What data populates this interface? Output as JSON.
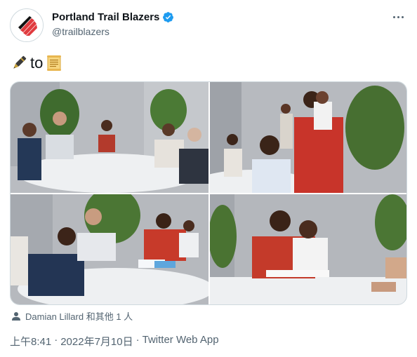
{
  "author": {
    "display_name": "Portland Trail Blazers",
    "handle": "@trailblazers",
    "verified": true,
    "avatar_icon": "trail-blazers-pinwheel-logo",
    "brand_color": "#e03a3e"
  },
  "tweet": {
    "emoji_before": "pen-icon",
    "text": "to",
    "emoji_after": "scroll-icon"
  },
  "media": {
    "count": 4,
    "photos": [
      {
        "id": "photo-1"
      },
      {
        "id": "photo-2"
      },
      {
        "id": "photo-3"
      },
      {
        "id": "photo-4"
      }
    ]
  },
  "tagged": {
    "text": "Damian Lillard 和其他 1 人",
    "icon": "person-icon"
  },
  "meta": {
    "time": "上午8:41",
    "separator": "·",
    "date": "2022年7月10日",
    "source": "Twitter Web App"
  },
  "colors": {
    "text_primary": "#0f1419",
    "text_secondary": "#536471",
    "verified_blue": "#1d9bf0",
    "border": "#cfd9de"
  }
}
